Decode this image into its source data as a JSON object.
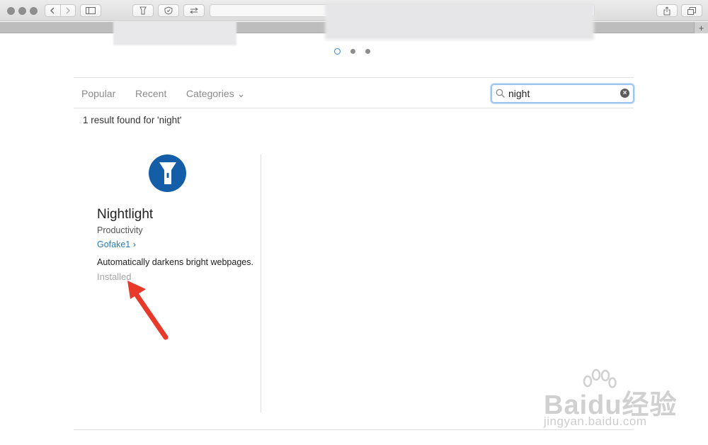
{
  "browser": {
    "icons": [
      "back-icon",
      "forward-icon",
      "sidebar-icon",
      "flashlight-extension-icon",
      "shield-extension-icon",
      "swap-extension-icon",
      "share-icon",
      "tabs-overview-icon",
      "new-tab-icon"
    ],
    "new_tab_label": "+"
  },
  "gallery": {
    "nav": {
      "popular": "Popular",
      "recent": "Recent",
      "categories": "Categories ⌄"
    },
    "search": {
      "value": "night"
    },
    "result_count": "1 result found for 'night'",
    "results": [
      {
        "name": "Nightlight",
        "category": "Productivity",
        "developer": "Gofake1 ›",
        "description": "Automatically darkens bright webpages.",
        "status": "Installed",
        "icon": "flashlight-icon",
        "icon_color": "#135ea7"
      }
    ]
  },
  "watermark": {
    "logo": "Baidu经验",
    "url": "jingyan.baidu.com"
  },
  "colors": {
    "accent": "#2a7ab8",
    "annotation_arrow": "#e8392a"
  }
}
